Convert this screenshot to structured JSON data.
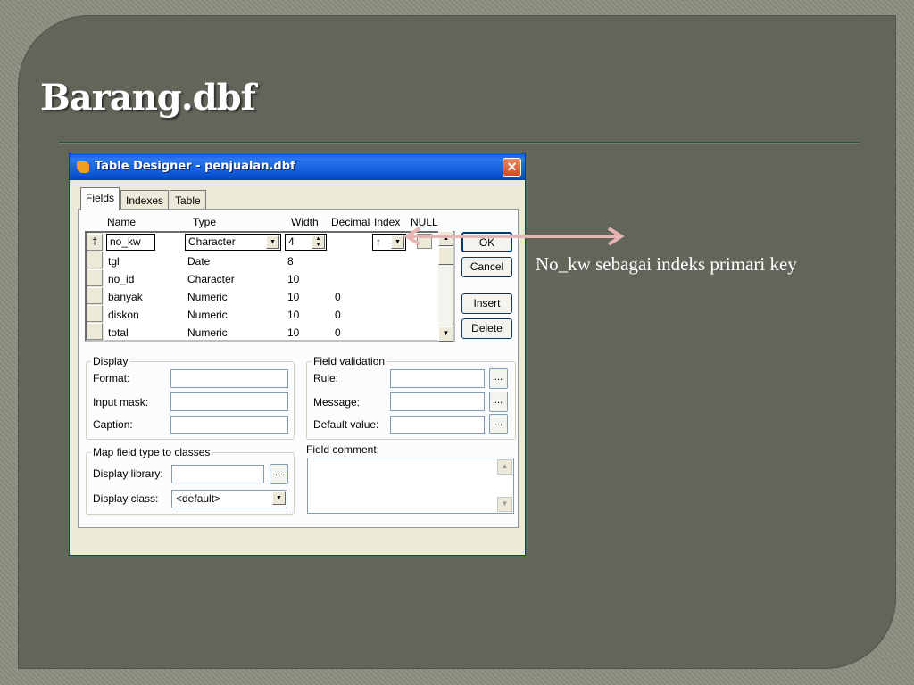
{
  "slide": {
    "title": "Barang.dbf",
    "caption": "No_kw sebagai indeks primari key"
  },
  "window": {
    "title": "Table Designer - penjualan.dbf",
    "close_glyph": "✕",
    "tabs": [
      "Fields",
      "Indexes",
      "Table"
    ],
    "columns": {
      "name": "Name",
      "type": "Type",
      "width": "Width",
      "decimal": "Decimal",
      "index": "Index",
      "null": "NULL"
    },
    "rows": [
      {
        "name": "no_kw",
        "type": "Character",
        "width": "4",
        "decimal": "",
        "index": "↑"
      },
      {
        "name": "tgl",
        "type": "Date",
        "width": "8",
        "decimal": ""
      },
      {
        "name": "no_id",
        "type": "Character",
        "width": "10",
        "decimal": ""
      },
      {
        "name": "banyak",
        "type": "Numeric",
        "width": "10",
        "decimal": "0"
      },
      {
        "name": "diskon",
        "type": "Numeric",
        "width": "10",
        "decimal": "0"
      },
      {
        "name": "total",
        "type": "Numeric",
        "width": "10",
        "decimal": "0"
      }
    ],
    "row_selector": "‡",
    "buttons": {
      "ok": "OK",
      "cancel": "Cancel",
      "insert": "Insert",
      "delete": "Delete"
    },
    "display_group": {
      "label": "Display",
      "format": "Format:",
      "input_mask": "Input mask:",
      "caption": "Caption:"
    },
    "validation_group": {
      "label": "Field validation",
      "rule": "Rule:",
      "message": "Message:",
      "default_value": "Default value:"
    },
    "map_group": {
      "label": "Map field type to classes",
      "display_library": "Display library:",
      "display_class": "Display class:",
      "display_class_value": "<default>"
    },
    "field_comment_label": "Field comment:",
    "ellipsis": "..."
  },
  "colors": {
    "slide_bg": "#62665a",
    "titlebar": "#0a5ad8",
    "arrow": "#e8b4b4"
  }
}
